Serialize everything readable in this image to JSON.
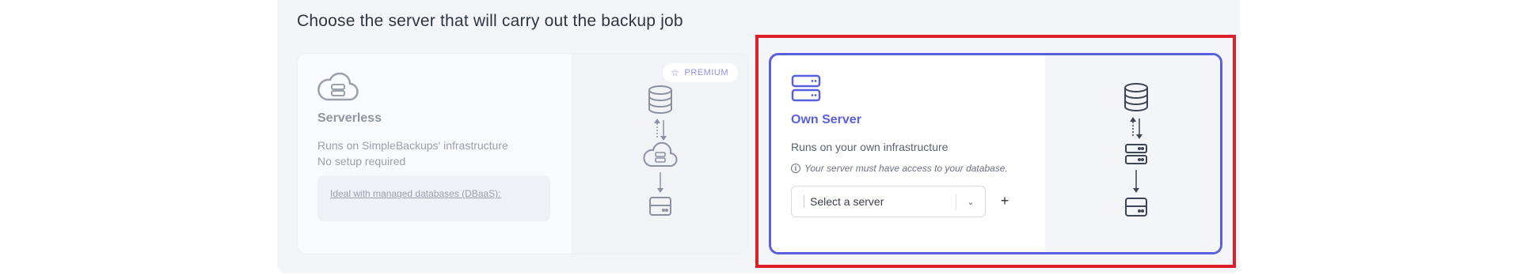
{
  "heading": "Choose the server that will carry out the backup job",
  "serverless": {
    "title": "Serverless",
    "desc_line1": "Runs on SimpleBackups' infrastructure",
    "desc_line2": "No setup required",
    "dbaas_link": "Ideal with managed databases (DBaaS):",
    "badge": "PREMIUM",
    "icon": "cloud-server-icon"
  },
  "own_server": {
    "title": "Own Server",
    "desc": "Runs on your own infrastructure",
    "note": "Your server must have access to your database.",
    "select_value": "Select a server",
    "add_label": "+",
    "icon": "server-stack-icon"
  },
  "colors": {
    "accent": "#5a5fe0",
    "highlight": "#dc1f2b",
    "muted": "#9aa1ab"
  }
}
